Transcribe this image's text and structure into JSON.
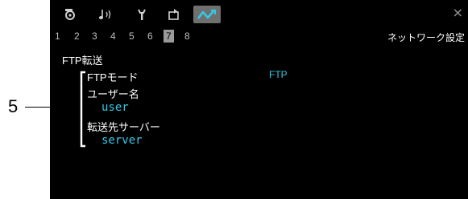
{
  "callout": {
    "number": "5"
  },
  "tabs": [
    {
      "icon": "camera-settings-icon"
    },
    {
      "icon": "audio-icon"
    },
    {
      "icon": "wrench-icon"
    },
    {
      "icon": "playback-icon"
    },
    {
      "icon": "network-icon",
      "active": true
    }
  ],
  "pages": [
    "1",
    "2",
    "3",
    "4",
    "5",
    "6",
    "7",
    "8"
  ],
  "selected_page": "7",
  "menu_title": "ネットワーク設定",
  "section_title": "FTP転送",
  "rows": [
    {
      "label": "FTPモード",
      "value": "FTP"
    },
    {
      "label": "ユーザー名",
      "value": "user"
    },
    {
      "label": "転送先サーバー",
      "value": "server"
    }
  ],
  "close_glyph": "×",
  "colors": {
    "background": "#000000",
    "value": "#35c9e6",
    "active_tab": "#6f6f6f"
  }
}
